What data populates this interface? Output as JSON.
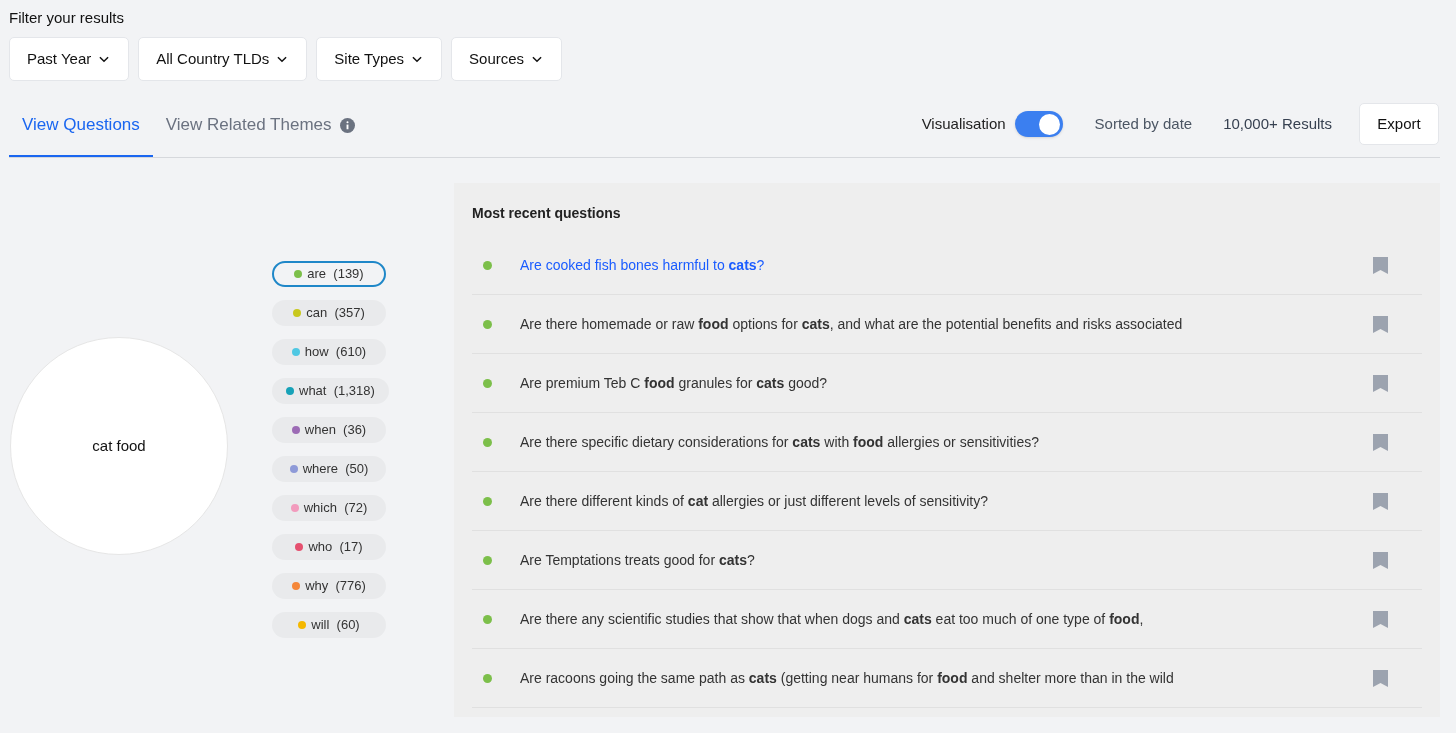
{
  "filter_title": "Filter your results",
  "filters": [
    "Past Year",
    "All Country TLDs",
    "Site Types",
    "Sources"
  ],
  "tabs": [
    {
      "label": "View Questions",
      "selected": true,
      "info": false
    },
    {
      "label": "View Related Themes",
      "selected": false,
      "info": true
    }
  ],
  "visualisation": {
    "label": "Visualisation",
    "on": true
  },
  "sort_label": "Sorted by date",
  "results_count": "10,000+ Results",
  "export_button": "Export",
  "center_topic": "cat food",
  "chips": [
    {
      "word": "are",
      "count": "(139)",
      "color": "#7cbf4a",
      "selected": true
    },
    {
      "word": "can",
      "count": "(357)",
      "color": "#c8c81e",
      "selected": false
    },
    {
      "word": "how",
      "count": "(610)",
      "color": "#4fc8e3",
      "selected": false
    },
    {
      "word": "what",
      "count": "(1,318)",
      "color": "#17a2b8",
      "selected": false
    },
    {
      "word": "when",
      "count": "(36)",
      "color": "#9c6bb5",
      "selected": false
    },
    {
      "word": "where",
      "count": "(50)",
      "color": "#8e9ad8",
      "selected": false
    },
    {
      "word": "which",
      "count": "(72)",
      "color": "#f29bbd",
      "selected": false
    },
    {
      "word": "who",
      "count": "(17)",
      "color": "#e5506f",
      "selected": false
    },
    {
      "word": "why",
      "count": "(776)",
      "color": "#f5873a",
      "selected": false
    },
    {
      "word": "will",
      "count": "(60)",
      "color": "#f5b800",
      "selected": false
    }
  ],
  "questions_panel": {
    "title": "Most recent questions",
    "questions": [
      {
        "text": "Are cooked fish bones harmful to **cats**?",
        "selected": true
      },
      {
        "text": "Are there homemade or raw **food** options for **cats**, and what are the potential benefits and risks associated",
        "selected": false
      },
      {
        "text": "Are premium Teb C **food** granules for **cats** good?",
        "selected": false
      },
      {
        "text": "Are there specific dietary considerations for **cats** with **food** allergies or sensitivities?",
        "selected": false
      },
      {
        "text": "Are there different kinds of **cat** allergies or just different levels of sensitivity?",
        "selected": false
      },
      {
        "text": "Are Temptations treats good for **cats**?",
        "selected": false
      },
      {
        "text": "Are there any scientific studies that show that when dogs and **cats** eat too much of one type of **food**,",
        "selected": false
      },
      {
        "text": "Are racoons going the same path as **cats** (getting near humans for **food** and shelter more than in the wild",
        "selected": false
      }
    ]
  }
}
